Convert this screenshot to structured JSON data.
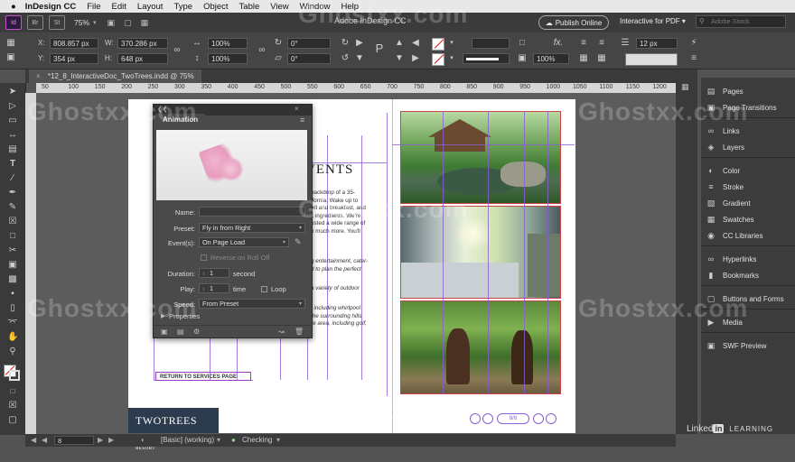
{
  "menubar": {
    "apple": "",
    "app": "InDesign CC",
    "items": [
      "File",
      "Edit",
      "Layout",
      "Type",
      "Object",
      "Table",
      "View",
      "Window",
      "Help"
    ]
  },
  "appbar": {
    "br_label": "Br",
    "st_label": "St",
    "zoom": "75%",
    "window_title": "Adobe InDesign CC",
    "publish_label": "Publish Online",
    "workspace": "Interactive for PDF",
    "search_placeholder": "Adobe Stock"
  },
  "control": {
    "x_label": "X:",
    "x": "808.857 px",
    "y_label": "Y:",
    "y": "354 px",
    "w_label": "W:",
    "w": "370.286 px",
    "h_label": "H:",
    "h": "648 px",
    "scale_x": "100%",
    "scale_y": "100%",
    "rotate": "0°",
    "shear": "0°",
    "stroke_weight": "12 px",
    "opacity": "100%"
  },
  "tab": {
    "label": "*12_8_InteractiveDoc_TwoTrees.indd @ 75%"
  },
  "ruler": {
    "ticks": [
      "50",
      "100",
      "150",
      "200",
      "250",
      "300",
      "350",
      "400",
      "450",
      "500",
      "550",
      "600",
      "650",
      "700",
      "750",
      "800",
      "850",
      "900",
      "950",
      "1000",
      "1050",
      "1100",
      "1150",
      "1200"
    ]
  },
  "page": {
    "heading": "VENTS",
    "body1": "backdrop of a 35-\nifornia. Wake up to\ned and breakfast, and\nc ingredients. We're\nosted a wide range of\nh much more. You'll",
    "body2": "g entertainment, cater-\nd to plan the perfect",
    "body3": "a variety of outdoor",
    "body4": ", including whirlpool\nthe surrounding hills\nre area, including golf,",
    "return": "RETURN TO SERVICES PAGE",
    "logo": "TWOTREES",
    "logo_small": "RESORT",
    "nav_mid": "8/8"
  },
  "animation": {
    "title": "Animation",
    "name_label": "Name:",
    "name_value": "",
    "preset_label": "Preset:",
    "preset_value": "Fly in from Right",
    "events_label": "Event(s):",
    "events_value": "On Page Load",
    "reverse_label": "Reverse on Roll Off",
    "duration_label": "Duration:",
    "duration_value": "1",
    "duration_unit": "second",
    "play_label": "Play:",
    "play_value": "1",
    "play_unit": "time",
    "loop_label": "Loop",
    "speed_label": "Speed:",
    "speed_value": "From Preset",
    "properties_label": "Properties"
  },
  "panels": [
    {
      "icon": "pages-icon",
      "label": "Pages"
    },
    {
      "icon": "page-transitions-icon",
      "label": "Page Transitions"
    },
    {
      "icon": "links-icon",
      "label": "Links"
    },
    {
      "icon": "layers-icon",
      "label": "Layers"
    },
    {
      "icon": "color-icon",
      "label": "Color"
    },
    {
      "icon": "stroke-icon",
      "label": "Stroke"
    },
    {
      "icon": "gradient-icon",
      "label": "Gradient"
    },
    {
      "icon": "swatches-icon",
      "label": "Swatches"
    },
    {
      "icon": "cc-libraries-icon",
      "label": "CC Libraries"
    },
    {
      "icon": "hyperlinks-icon",
      "label": "Hyperlinks"
    },
    {
      "icon": "bookmarks-icon",
      "label": "Bookmarks"
    },
    {
      "icon": "buttons-forms-icon",
      "label": "Buttons and Forms"
    },
    {
      "icon": "media-icon",
      "label": "Media"
    },
    {
      "icon": "swf-preview-icon",
      "label": "SWF Preview"
    }
  ],
  "status": {
    "page": "8",
    "style": "[Basic] (working)",
    "preflight": "Checking"
  },
  "brand": {
    "linkedin_a": "Linked",
    "linkedin_b": "in",
    "linkedin_c": "LEARNING"
  },
  "watermark": "Ghostxx.com",
  "colors": {
    "accent": "#8a5cd6",
    "frame": "#cc4444",
    "panel_bg": "#4a4a4a"
  }
}
